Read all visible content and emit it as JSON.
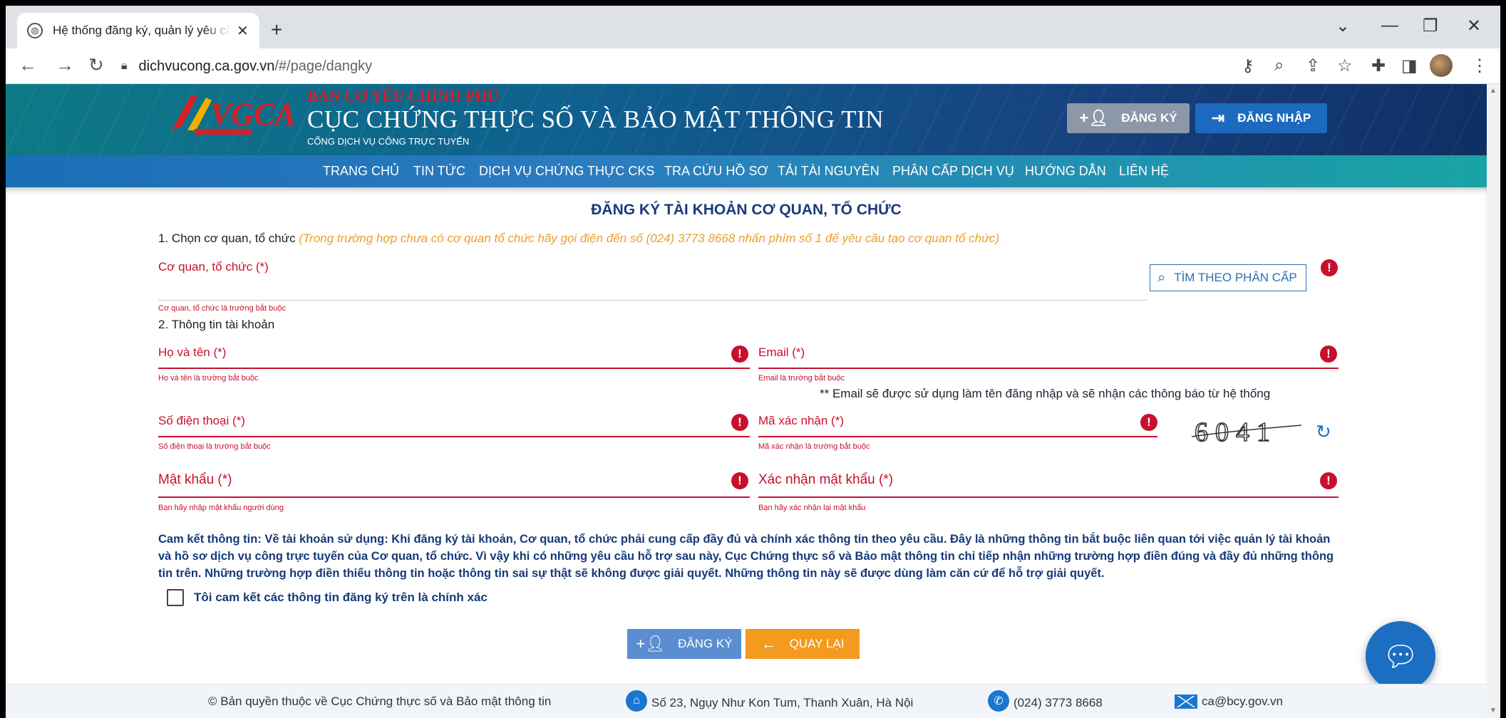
{
  "browser": {
    "tab_title": "Hệ thống đăng ký, quản lý yêu cầu",
    "new_tab": "+",
    "url_host": "dichvucong.ca.gov.vn",
    "url_path": "/#/page/dangky"
  },
  "header": {
    "logo_text": "VGCA",
    "brand_top": "BAN CƠ YẾU CHÍNH PHỦ",
    "brand_main": "CỤC CHỨNG THỰC SỐ VÀ BẢO MẬT THÔNG TIN",
    "brand_sub": "CỔNG DỊCH VỤ CÔNG TRỰC TUYẾN",
    "register_label": "ĐĂNG KÝ",
    "login_label": "ĐĂNG NHẬP"
  },
  "menu": [
    "TRANG CHỦ",
    "TIN TỨC",
    "DỊCH VỤ CHỨNG THỰC CKS",
    "TRA CỨU HỒ SƠ",
    "TẢI TÀI NGUYÊN",
    "PHÂN CẤP DỊCH VỤ",
    "HƯỚNG DẪN",
    "LIÊN HỆ"
  ],
  "form": {
    "title": "ĐĂNG KÝ TÀI KHOẢN CƠ QUAN, TỔ CHỨC",
    "section1": "1. Chọn cơ quan, tổ chức",
    "section1_note": "(Trong trường hợp chưa có cơ quan tổ chức hãy gọi điện đến số (024) 3773 8668 nhấn phím số 1 để yêu cầu tạo cơ quan tổ chức)",
    "org_label": "Cơ quan, tổ chức (*)",
    "org_help": "Cơ quan, tổ chức là trường bắt buộc",
    "search_label": "TÌM THEO PHÂN CẤP",
    "section2": "2. Thông tin tài khoản",
    "name_label": "Họ và tên (*)",
    "name_help": "Họ và tên là trường bắt buộc",
    "email_label": "Email (*)",
    "email_help": "Email là trường bắt buộc",
    "email_note": "** Email sẽ được sử dụng làm tên đăng nhập và sẽ nhận các thông báo từ hệ thống",
    "phone_label": "Số điện thoại (*)",
    "phone_help": "Số điện thoại là trường bắt buộc",
    "captcha_label": "Mã xác nhận (*)",
    "captcha_help": "Mã xác nhận là trường bắt buộc",
    "captcha_text": "6041",
    "password_label": "Mật khẩu (*)",
    "password_help": "Bạn hãy nhập mật khẩu người dùng",
    "confirm_label": "Xác nhận mật khẩu (*)",
    "confirm_help": "Bạn hãy xác nhận lại mật khẩu",
    "error_mark": "!",
    "pledge": "Cam kết thông tin: Về tài khoản sử dụng: Khi đăng ký tài khoản, Cơ quan, tổ chức phải cung cấp đầy đủ và chính xác thông tin theo yêu cầu. Đây là những thông tin bắt buộc liên quan tới việc quản lý tài khoản và hồ sơ dịch vụ công trực tuyến của Cơ quan, tổ chức. Vì vậy khi có những yêu cầu hỗ trợ sau này, Cục Chứng thực số và Bảo mật thông tin chỉ tiếp nhận những trường hợp điền đúng và đầy đủ những thông tin trên. Những trường hợp điền thiếu thông tin hoặc thông tin sai sự thật sẽ không được giải quyết. Những thông tin này sẽ được dùng làm căn cứ để hỗ trợ giải quyết.",
    "agree_label": "Tôi cam kết các thông tin đăng ký trên là chính xác",
    "register_button": "ĐĂNG KÝ",
    "back_button": "QUAY LẠI"
  },
  "footer": {
    "copyright": "© Bản quyền thuộc về Cục Chứng thực số và Bảo mật thông tin",
    "address": "Số 23, Ngụy Như Kon Tum, Thanh Xuân, Hà Nội",
    "phone": "(024) 3773 8668",
    "email": "ca@bcy.gov.vn"
  },
  "colors": {
    "error_red": "#c8102e",
    "primary_blue": "#1c6ac0",
    "warning_orange": "#f39a1f",
    "pledge_text": "#163a7a"
  },
  "icons": [
    "globe-icon",
    "close-icon",
    "back-arrow-icon",
    "forward-arrow-icon",
    "reload-icon",
    "lock-icon",
    "key-icon",
    "zoom-icon",
    "share-icon",
    "star-icon",
    "extensions-icon",
    "sidepanel-icon",
    "menu-dots-icon",
    "add-user-icon",
    "login-icon",
    "search-icon",
    "refresh-icon",
    "arrow-left-icon",
    "chat-icon",
    "location-icon",
    "phone-icon",
    "mail-icon"
  ]
}
